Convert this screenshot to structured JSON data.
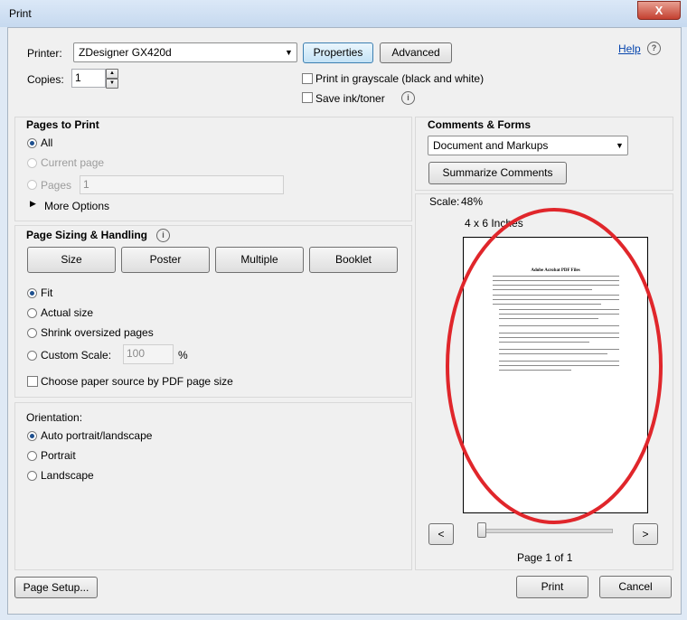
{
  "window": {
    "title": "Print",
    "close_label": "X"
  },
  "printer": {
    "label": "Printer:",
    "selected": "ZDesigner GX420d",
    "properties_label": "Properties",
    "advanced_label": "Advanced",
    "help_label": "Help",
    "copies_label": "Copies:",
    "copies_value": "1",
    "grayscale_label": "Print in grayscale (black and white)",
    "save_ink_label": "Save ink/toner"
  },
  "pages_to_print": {
    "title": "Pages to Print",
    "all_label": "All",
    "current_label": "Current page",
    "pages_label": "Pages",
    "pages_value": "1",
    "more_options_label": "More Options"
  },
  "sizing": {
    "title": "Page Sizing & Handling",
    "tabs": [
      "Size",
      "Poster",
      "Multiple",
      "Booklet"
    ],
    "fit_label": "Fit",
    "actual_label": "Actual size",
    "shrink_label": "Shrink oversized pages",
    "custom_label": "Custom Scale:",
    "custom_value": "100",
    "percent": "%",
    "paper_source_label": "Choose paper source by PDF page size"
  },
  "orientation": {
    "title": "Orientation:",
    "auto_label": "Auto portrait/landscape",
    "portrait_label": "Portrait",
    "landscape_label": "Landscape"
  },
  "comments": {
    "title": "Comments & Forms",
    "selected": "Document and Markups",
    "summarize_label": "Summarize Comments"
  },
  "preview": {
    "scale_label": "Scale:",
    "scale_value": "48%",
    "paper_size": "4 x 6 Inches",
    "doc_title": "Adobe Acrobat PDF Files",
    "prev_label": "<",
    "next_label": ">",
    "page_info": "Page 1 of 1"
  },
  "footer": {
    "page_setup_label": "Page Setup...",
    "print_label": "Print",
    "cancel_label": "Cancel"
  },
  "colors": {
    "annotation_ellipse": "#e0262b",
    "title_bar": "#c6d9ef"
  }
}
